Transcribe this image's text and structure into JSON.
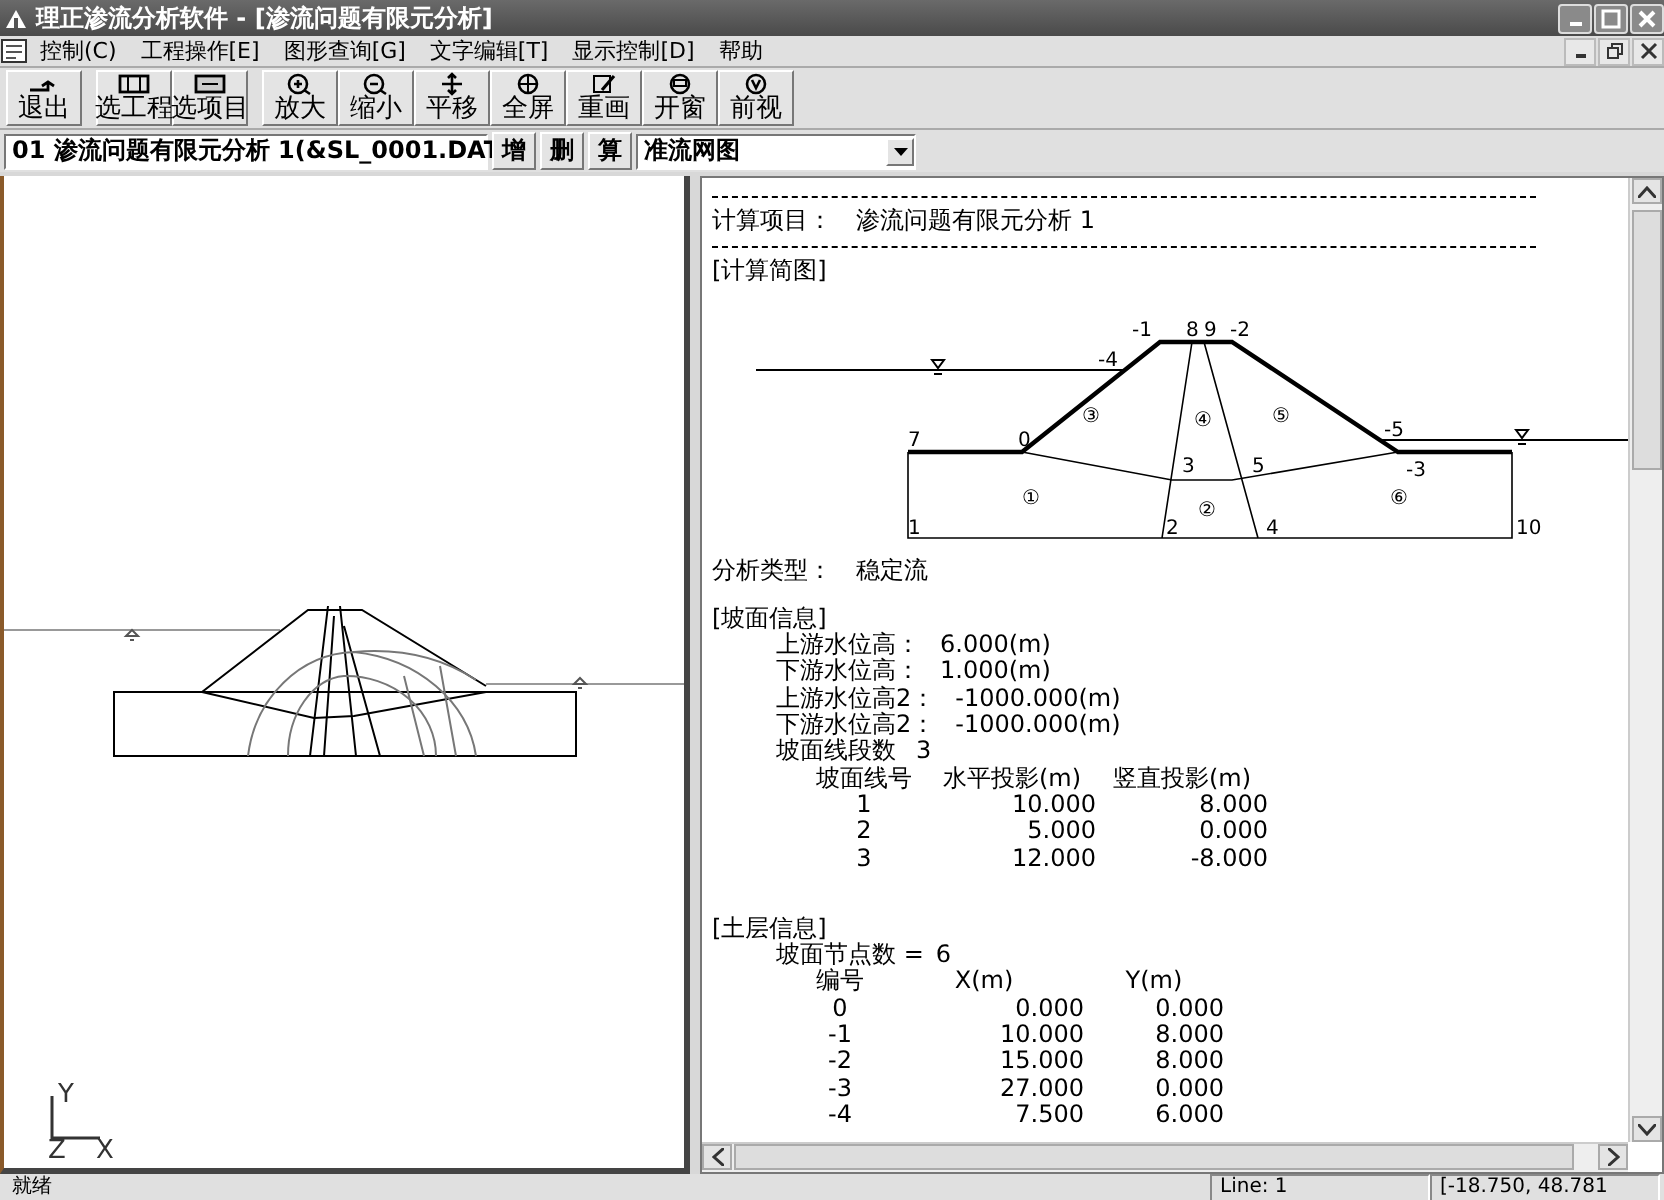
{
  "window": {
    "title": "理正渗流分析软件 - [渗流问题有限元分析]"
  },
  "menu": [
    "控制(C)",
    "工程操作[E]",
    "图形查询[G]",
    "文字编辑[T]",
    "显示控制[D]",
    "帮助"
  ],
  "toolbar": {
    "groups": [
      [
        {
          "label": "退出"
        }
      ],
      [
        {
          "label": "选工程"
        },
        {
          "label": "选项目"
        }
      ],
      [
        {
          "label": "放大"
        },
        {
          "label": "缩小"
        },
        {
          "label": "平移"
        },
        {
          "label": "全屏"
        },
        {
          "label": "重画"
        },
        {
          "label": "开窗"
        },
        {
          "label": "前视"
        }
      ]
    ]
  },
  "project_bar": {
    "project": "01  渗流问题有限元分析 1(&SL_0001.DAT",
    "actions": [
      "增",
      "删",
      "算"
    ],
    "view": "准流网图"
  },
  "graphics_view": {
    "axis_labels": [
      "Y",
      "Z",
      "X"
    ]
  },
  "report": {
    "project": {
      "label": "计算项目：",
      "value": "渗流问题有限元分析 1"
    },
    "diagram": {
      "heading": "[计算简图]",
      "labels": [
        "-1",
        "8",
        "9",
        "-2",
        "-4",
        "③",
        "④",
        "⑤",
        "7",
        "0",
        "-5",
        "3",
        "5",
        "-3",
        "①",
        "②",
        "⑥",
        "1",
        "2",
        "4",
        "10"
      ]
    },
    "analysis_type": {
      "label": "分析类型：",
      "value": "稳定流"
    },
    "slope": {
      "heading": "[坡面信息]",
      "fields": [
        {
          "label": "上游水位高：",
          "value": "6.000(m)"
        },
        {
          "label": "下游水位高：",
          "value": "1.000(m)"
        },
        {
          "label": "上游水位高2：",
          "value": "-1000.000(m)"
        },
        {
          "label": "下游水位高2：",
          "value": "-1000.000(m)"
        },
        {
          "label": "坡面线段数",
          "value": "3"
        }
      ],
      "table": {
        "columns": [
          "坡面线号",
          "水平投影(m)",
          "竖直投影(m)"
        ],
        "rows": [
          [
            "1",
            "10.000",
            "8.000"
          ],
          [
            "2",
            "5.000",
            "0.000"
          ],
          [
            "3",
            "12.000",
            "-8.000"
          ]
        ]
      }
    },
    "soil": {
      "heading": "[土层信息]",
      "count": {
        "label": "坡面节点数 =",
        "value": "6"
      },
      "table": {
        "columns": [
          "编号",
          "X(m)",
          "Y(m)"
        ],
        "rows": [
          [
            "0",
            "0.000",
            "0.000"
          ],
          [
            "-1",
            "10.000",
            "8.000"
          ],
          [
            "-2",
            "15.000",
            "8.000"
          ],
          [
            "-3",
            "27.000",
            "0.000"
          ],
          [
            "-4",
            "7.500",
            "6.000"
          ]
        ]
      }
    }
  },
  "status_bar": [
    "就绪",
    "Line: 1",
    "[-18.750, 48.781"
  ]
}
